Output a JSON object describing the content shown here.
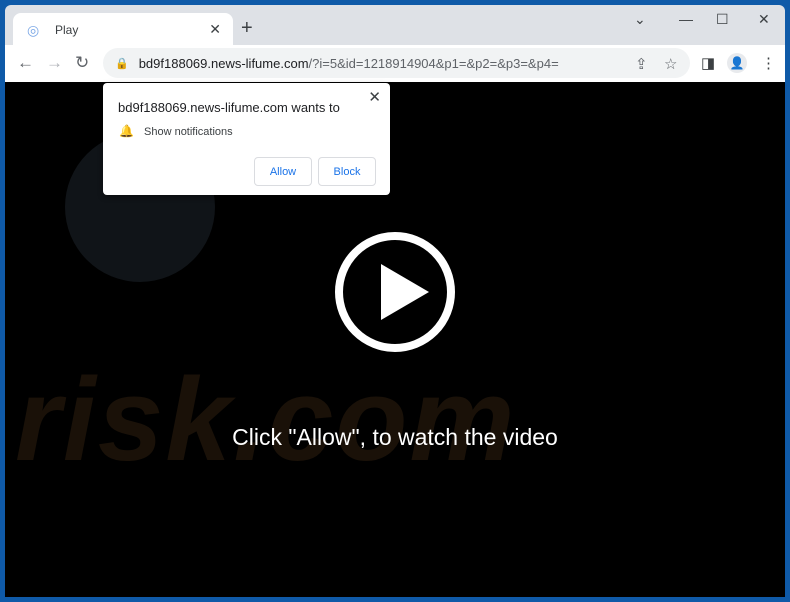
{
  "tab": {
    "title": "Play",
    "icon": "globe-icon"
  },
  "address": {
    "host": "bd9f188069.news-lifume.com",
    "path": "/?i=5&id=1218914904&p1=&p2=&p3=&p4="
  },
  "popup": {
    "title": "bd9f188069.news-lifume.com wants to",
    "permission": "Show notifications",
    "allow": "Allow",
    "block": "Block"
  },
  "content": {
    "message": "Click \"Allow\", to watch the video",
    "watermark": "risk.com"
  }
}
